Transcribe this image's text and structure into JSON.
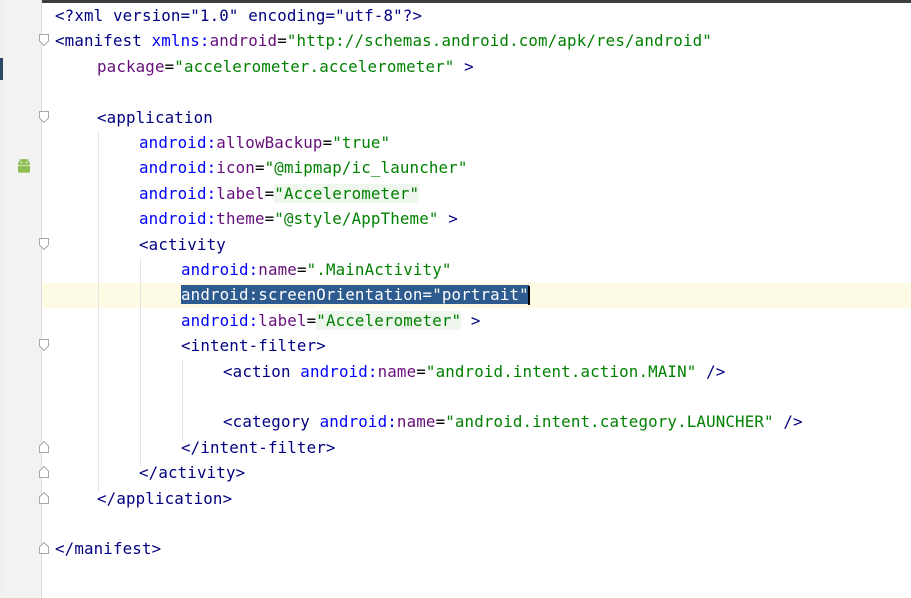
{
  "editor": {
    "lines": [
      {
        "line": 1,
        "indent": 0,
        "parts": [
          [
            "t",
            "<?xml version=\"1.0\" encoding=\"utf-8\"?>"
          ]
        ]
      },
      {
        "line": 2,
        "indent": 0,
        "parts": [
          [
            "t",
            "<manifest "
          ],
          [
            "ns",
            "xmlns:"
          ],
          [
            "a",
            "android"
          ],
          [
            "p",
            "="
          ],
          [
            "v",
            "\"http://schemas.android.com/apk/res/android\""
          ]
        ]
      },
      {
        "line": 3,
        "indent": 1,
        "parts": [
          [
            "a",
            "package"
          ],
          [
            "p",
            "="
          ],
          [
            "v",
            "\"accelerometer.accelerometer\""
          ],
          [
            "p",
            " "
          ],
          [
            "t",
            ">"
          ]
        ]
      },
      {
        "line": 4,
        "indent": 0,
        "parts": []
      },
      {
        "line": 5,
        "indent": 1,
        "parts": [
          [
            "t",
            "<application"
          ]
        ]
      },
      {
        "line": 6,
        "indent": 2,
        "parts": [
          [
            "ns",
            "android:"
          ],
          [
            "a",
            "allowBackup"
          ],
          [
            "p",
            "="
          ],
          [
            "v",
            "\"true\""
          ]
        ]
      },
      {
        "line": 7,
        "indent": 2,
        "parts": [
          [
            "ns",
            "android:"
          ],
          [
            "a",
            "icon"
          ],
          [
            "p",
            "="
          ],
          [
            "v",
            "\"@mipmap/ic_launcher\""
          ]
        ]
      },
      {
        "line": 8,
        "indent": 2,
        "parts": [
          [
            "ns",
            "android:"
          ],
          [
            "a",
            "label"
          ],
          [
            "p",
            "="
          ],
          [
            "hl",
            "\"Accelerometer\""
          ]
        ]
      },
      {
        "line": 9,
        "indent": 2,
        "parts": [
          [
            "ns",
            "android:"
          ],
          [
            "a",
            "theme"
          ],
          [
            "p",
            "="
          ],
          [
            "v",
            "\"@style/AppTheme\""
          ],
          [
            "p",
            " "
          ],
          [
            "t",
            ">"
          ]
        ]
      },
      {
        "line": 10,
        "indent": 2,
        "parts": [
          [
            "t",
            "<activity"
          ]
        ]
      },
      {
        "line": 11,
        "indent": 3,
        "parts": [
          [
            "ns",
            "android:"
          ],
          [
            "a",
            "name"
          ],
          [
            "p",
            "="
          ],
          [
            "v",
            "\".MainActivity\""
          ]
        ]
      },
      {
        "line": 12,
        "indent": 3,
        "selected": true,
        "parts": [
          [
            "ns",
            "android:"
          ],
          [
            "a",
            "screenOrientation"
          ],
          [
            "p",
            "="
          ],
          [
            "v",
            "\"portrait\""
          ]
        ]
      },
      {
        "line": 13,
        "indent": 3,
        "parts": [
          [
            "ns",
            "android:"
          ],
          [
            "a",
            "label"
          ],
          [
            "p",
            "="
          ],
          [
            "hl",
            "\"Accelerometer\""
          ],
          [
            "p",
            " "
          ],
          [
            "t",
            ">"
          ]
        ]
      },
      {
        "line": 14,
        "indent": 3,
        "parts": [
          [
            "t",
            "<intent-filter>"
          ]
        ]
      },
      {
        "line": 15,
        "indent": 4,
        "parts": [
          [
            "t",
            "<action "
          ],
          [
            "ns",
            "android:"
          ],
          [
            "a",
            "name"
          ],
          [
            "p",
            "="
          ],
          [
            "v",
            "\"android.intent.action.MAIN\""
          ],
          [
            "p",
            " "
          ],
          [
            "t",
            "/>"
          ]
        ]
      },
      {
        "line": 16,
        "indent": 0,
        "parts": []
      },
      {
        "line": 17,
        "indent": 4,
        "parts": [
          [
            "t",
            "<category "
          ],
          [
            "ns",
            "android:"
          ],
          [
            "a",
            "name"
          ],
          [
            "p",
            "="
          ],
          [
            "v",
            "\"android.intent.category.LAUNCHER\""
          ],
          [
            "p",
            " "
          ],
          [
            "t",
            "/>"
          ]
        ]
      },
      {
        "line": 18,
        "indent": 3,
        "parts": [
          [
            "t",
            "</intent-filter>"
          ]
        ]
      },
      {
        "line": 19,
        "indent": 2,
        "parts": [
          [
            "t",
            "</activity>"
          ]
        ]
      },
      {
        "line": 20,
        "indent": 1,
        "parts": [
          [
            "t",
            "</application>"
          ]
        ]
      },
      {
        "line": 21,
        "indent": 0,
        "parts": []
      },
      {
        "line": 22,
        "indent": 0,
        "parts": [
          [
            "t",
            "</manifest>"
          ]
        ]
      }
    ],
    "fold_markers": [
      {
        "line": 2,
        "kind": "open"
      },
      {
        "line": 5,
        "kind": "open"
      },
      {
        "line": 10,
        "kind": "open"
      },
      {
        "line": 14,
        "kind": "open"
      },
      {
        "line": 18,
        "kind": "close"
      },
      {
        "line": 19,
        "kind": "close"
      },
      {
        "line": 20,
        "kind": "close"
      },
      {
        "line": 22,
        "kind": "close"
      }
    ],
    "gutter_icons": [
      {
        "line": 7,
        "icon": "android-icon",
        "color": "#8bbd52"
      }
    ],
    "colors": {
      "tag": "#000080",
      "attribute": "#660e7a",
      "namespace": "#0000ff",
      "value": "#008000",
      "selection": "#2d5a8f",
      "current_line": "#fdfbe4"
    }
  }
}
